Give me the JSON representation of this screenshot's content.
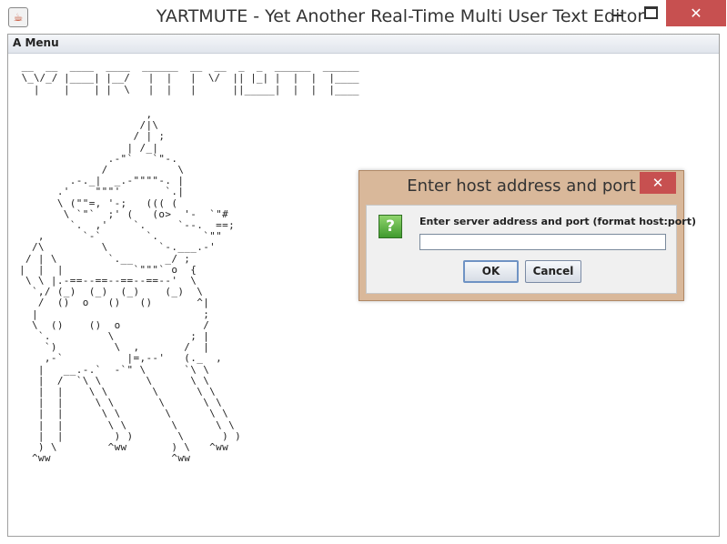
{
  "window": {
    "title": "YARTMUTE - Yet Another Real-Time Multi User Text Editor",
    "icon": "java-coffee-icon",
    "minimize_glyph": "",
    "close_glyph": "✕"
  },
  "menu": {
    "items": [
      "A Menu"
    ]
  },
  "banner_art": " __  __  ____  ____  ______  __  __  _  _  ______  ______\n \\_\\/_/ |____| |__/   |  |   |  \\/  || |_| |  |  |  |____\n   |    |    | |  \\   |  |   |      ||_____|  |  |  |____",
  "ascii_art": "                    ,\n                   /|\\\n                  / | ;\n                 | /_|\n              .-\"`   `\"-.\n             /           \\\n        .-._|  _.-\"\"\"\"-. |\n      .'    \"\"\"'       `.|\n      \\ (\"\"=, '-;   ((( (\n       \\ `\"`  ;' (   (o>  '-  `\"#\n        `.  ,'    `.     `--.  ==;\n   ,      `-`       `.       `\"\"\n  /\\         \\        `-.___.-'\n / | \\        `.__     _/ ;\n|  |  |           `\"\"\"` o  {\n \\ \\ |.-==--==--==--==--'  \\\n  `,/ (_)  (_)  (_)    (_)  \\\n   /  ()  o   ()   ()       ^|\n  |                          ;\n  \\  ()    ()  o             /\n   `.         \\            ; |\n    `)         \\  ,       /  |\n    ,-`          |=,--'   (._  ,\n   |   __.-.`  -`\" \\      `\\ \\\n   |  /  `\\ \\       \\      \\ \\\n   |  |    \\ \\       \\      \\ \\\n   |  |     \\ \\       \\      \\ \\\n   |  |      \\ \\       \\      \\ \\\n   |  |       \\ \\       \\      \\ \\\n   |  |        ) )       \\      ) )\n   ) \\        ^ww       ) \\   ^ww\n  ^ww                   ^ww",
  "dialog": {
    "title": "Enter host address and port",
    "close_glyph": "✕",
    "icon": "question-icon",
    "icon_glyph": "?",
    "prompt": "Enter server address and port (format host:port)",
    "input_value": "",
    "ok_label": "OK",
    "cancel_label": "Cancel"
  },
  "colors": {
    "dialog_frame": "#d9b89a",
    "close_button": "#c75050",
    "question_icon": "#4fa83a"
  }
}
